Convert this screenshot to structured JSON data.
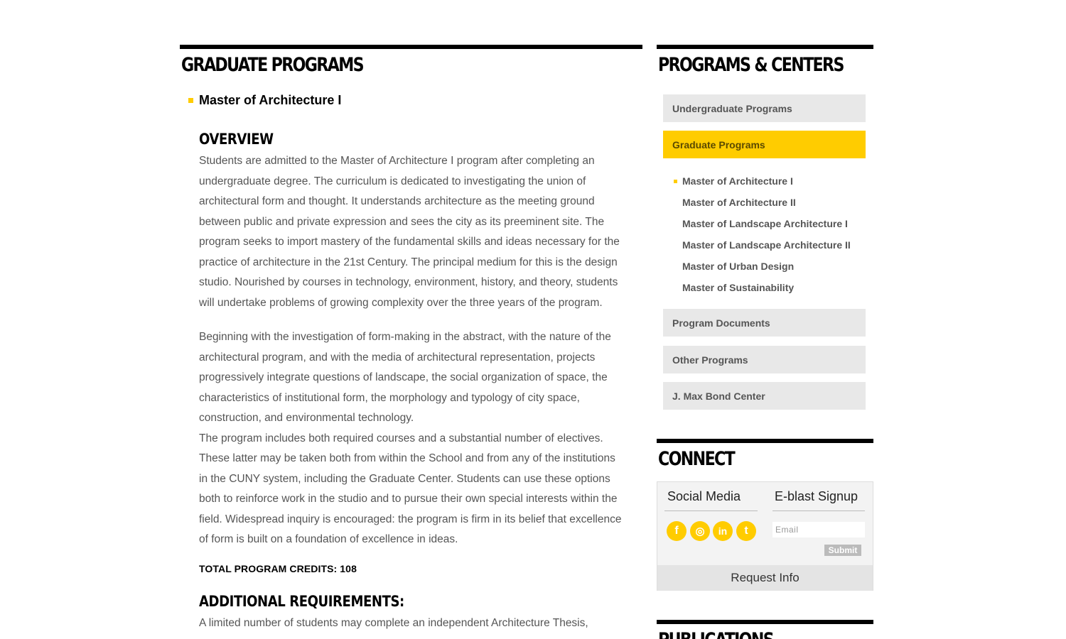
{
  "main": {
    "section_title": "GRADUATE PROGRAMS",
    "program_title": "Master of Architecture I",
    "overview_heading": "OVERVIEW",
    "paragraphs": [
      "Students are admitted to the Master of Architecture I program after completing an undergraduate degree. The curriculum is dedicated to investigating the union of architectural form and thought. It understands architecture as the meeting ground between public and private expression and sees the city as its preeminent site. The program seeks to import mastery of the fundamental skills and ideas necessary for the practice of architecture in the 21st Century. The principal medium for this is the design studio. Nourished by courses in technology, environment, history, and theory, students will undertake problems of growing complexity over the three years of the program.",
      "Beginning with the investigation of form-making in the abstract, with the nature of the architectural program, and with the media of architectural representation, projects progressively integrate questions of landscape, the social organization of space, the characteristics of institutional form, the morphology and typology of city space, construction, and environmental technology.",
      "The program includes both required courses and a substantial number of electives. These latter may be taken both from within the School and from any of the institutions in the CUNY system, including the Graduate Center. Students can use these options both to reinforce work in the studio and to pursue their own special interests within the field. Widespread inquiry is encouraged: the program is firm in its belief that excellence of form is built on a foundation of excellence in ideas."
    ],
    "credits": "TOTAL PROGRAM CREDITS: 108",
    "additional_heading": "ADDITIONAL REQUIREMENTS:",
    "additional_text": "A limited number of students may complete an independent Architecture Thesis,"
  },
  "sidebar": {
    "section_title": "PROGRAMS & CENTERS",
    "nav": {
      "undergrad": "Undergraduate Programs",
      "graduate": "Graduate Programs",
      "documents": "Program Documents",
      "other": "Other Programs",
      "bond": "J. Max Bond Center"
    },
    "sub_items": [
      "Master of Architecture I",
      "Master of Architecture II",
      "Master of Landscape Architecture I",
      "Master of Landscape Architecture II",
      "Master of Urban Design",
      "Master of Sustainability"
    ],
    "connect": {
      "title": "CONNECT",
      "social_title": "Social Media",
      "eblast_title": "E-blast Signup",
      "email_placeholder": "Email",
      "submit_label": "Submit",
      "request_label": "Request Info",
      "icons": {
        "facebook": "f",
        "instagram": "◎",
        "linkedin": "in",
        "twitter": "t"
      }
    },
    "publications_title": "PUBLICATIONS"
  },
  "colors": {
    "accent": "#ffcc00",
    "nav_bg": "#e8e8e8",
    "body_text": "#555555"
  }
}
